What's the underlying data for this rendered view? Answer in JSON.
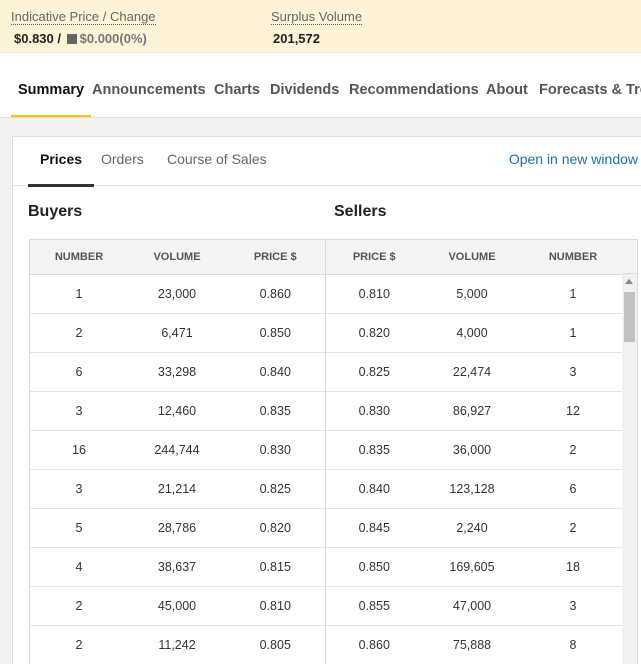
{
  "banner": {
    "price_label": "Indicative Price / Change",
    "price": "$0.830 /",
    "change": "$0.000(0%)",
    "surplus_label": "Surplus Volume",
    "surplus": "201,572"
  },
  "main_tabs": [
    "Summary",
    "Announcements",
    "Charts",
    "Dividends",
    "Recommendations",
    "About",
    "Forecasts & Trends"
  ],
  "sub_tabs": [
    "Prices",
    "Orders",
    "Course of Sales"
  ],
  "open_new_window": "Open in new window",
  "buyers_title": "Buyers",
  "sellers_title": "Sellers",
  "columns": [
    "NUMBER",
    "VOLUME",
    "PRICE $",
    "PRICE $",
    "VOLUME",
    "NUMBER"
  ],
  "rows": [
    [
      "1",
      "23,000",
      "0.860",
      "0.810",
      "5,000",
      "1"
    ],
    [
      "2",
      "6,471",
      "0.850",
      "0.820",
      "4,000",
      "1"
    ],
    [
      "6",
      "33,298",
      "0.840",
      "0.825",
      "22,474",
      "3"
    ],
    [
      "3",
      "12,460",
      "0.835",
      "0.830",
      "86,927",
      "12"
    ],
    [
      "16",
      "244,744",
      "0.830",
      "0.835",
      "36,000",
      "2"
    ],
    [
      "3",
      "21,214",
      "0.825",
      "0.840",
      "123,128",
      "6"
    ],
    [
      "5",
      "28,786",
      "0.820",
      "0.845",
      "2,240",
      "2"
    ],
    [
      "4",
      "38,637",
      "0.815",
      "0.850",
      "169,605",
      "18"
    ],
    [
      "2",
      "45,000",
      "0.810",
      "0.855",
      "47,000",
      "3"
    ],
    [
      "2",
      "11,242",
      "0.805",
      "0.860",
      "75,888",
      "8"
    ]
  ],
  "colors": {
    "accent": "#f5c400",
    "link": "#1a6fb5",
    "banner_bg": "#fdf3d6"
  }
}
